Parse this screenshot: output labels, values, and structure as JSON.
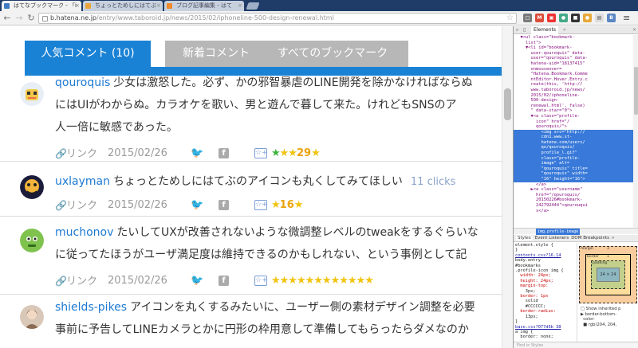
{
  "browser": {
    "tabs": [
      {
        "title": "はてなブックマーク - 「i",
        "active": true
      },
      {
        "title": "ちょっとためしにはてぶ",
        "active": false
      },
      {
        "title": "ブログ記事編集 - はて",
        "active": false
      }
    ],
    "url_host": "b.hatena.ne.jp",
    "url_path": "/entry/www.taboroid.jp/news/2015/02/iphoneline-500-design-renewal.html"
  },
  "comment_tabs": {
    "popular": "人気コメント (10)",
    "new": "新着コメント",
    "all": "すべてのブックマーク"
  },
  "comments": [
    {
      "user": "qouroquis",
      "line1": "少女は激怒した。必ず、かの邪智暴虐のLINE開発を除かなければならぬ",
      "line2": "にはUIがわからぬ。カラオケを歌い、男と遊んで暮して来た。けれどもSNSのア",
      "line3": "人一倍に敏感であった。",
      "link_label": "リンク",
      "date": "2015/02/26",
      "stars": "★★",
      "star_count": "29",
      "star_suffix": "★"
    },
    {
      "user": "uxlayman",
      "line1": "ちょっとためしにはてぶのアイコンも丸くしてみてほしい",
      "clicks": "11 clicks",
      "link_label": "リンク",
      "date": "2015/02/26",
      "stars": "★",
      "star_count": "16",
      "star_suffix": "★"
    },
    {
      "user": "muchonov",
      "line1": "たいしてUXが改善されないような微調整レベルのtweakをするぐらいな",
      "line2": "に従ってたほうがユーザ満足度は維持できるのかもしれない、という事例として記",
      "link_label": "リンク",
      "date": "2015/02/26",
      "stars": "★★★★★★★★★★★★",
      "star_count": "",
      "star_suffix": ""
    },
    {
      "user": "shields-pikes",
      "line1": "アイコンを丸くするみたいに、ユーザー側の素材デザイン調整を必要",
      "line2": "事前に予告してLINEカメラとかに円形の枠用意して準備してもらったらダメなのか"
    }
  ],
  "devtools": {
    "tab_elements": "Elements",
    "dom_lines": [
      "  ▼<ul class=\"bookmark-",
      "    list\">",
      "    ▼<li id=\"bookmark-",
      "      user-qouroquis\" data-",
      "      user=\"qouroquis\" data-",
      "      hatena-uid=\"18137415\"",
      "      onmouseover=",
      "      \"Hatena.Bookmark.Comme",
      "      ntEditor.Hover.Entry.c",
      "      reate(this, 'http://",
      "      www.taboroid.jp/news/",
      "      2015/02/iphoneline-",
      "      500-design-",
      "      renewal.html', false)",
      "      \" data-star=\"0\">",
      "      ▼<a class=\"profile-",
      "        icon\" href=\"/",
      "        qouroquis/\">",
      "          <img src=\"http://",
      "          cdn1.www.st-",
      "          hatena.com/users/",
      "          qo/qouroquis/",
      "          profile_l.gif\"",
      "          class=\"profile-",
      "          image\" alt=",
      "          \"qouroquis\" title=",
      "          \"qouroquis\" width=",
      "          \"16\" height=\"16\">",
      "        </a>",
      "      ▶<a class=\"username\"",
      "        href=\"/qouroquis/",
      "        20150226#bookmark-",
      "        242792444\">qourouqui",
      "        s</a>"
    ],
    "breadcrumb": "img.profile-image",
    "style_tabs": [
      "Styles",
      "Event Listeners",
      "DOM Breakpoints",
      "»"
    ],
    "style_lines": [
      "element.style {",
      "}",
      "contents.css?16.14",
      "body.entry",
      "#bookmarks",
      ".profile-icon img {",
      "  width: 24px;",
      "  height: 24px;",
      "  margin-top:",
      "    3px;",
      "  border: 1px",
      "    solid",
      "    #CCCCCC;",
      "  border-radius:",
      "    13px;",
      "}",
      "base.css?077d6b_38",
      "a img {",
      "  border: none;"
    ],
    "box_labels": {
      "margin": "margin",
      "border": "border",
      "padding": "padding",
      "content": "24 × 24",
      "margin_top": "3",
      "border_top": "1"
    },
    "computed_lines": [
      "□ Show inherited p",
      "▶ border-bottom-",
      "  color:",
      "  ■ rgb(204, 204,"
    ],
    "find_placeholder": "Find in Styles"
  }
}
